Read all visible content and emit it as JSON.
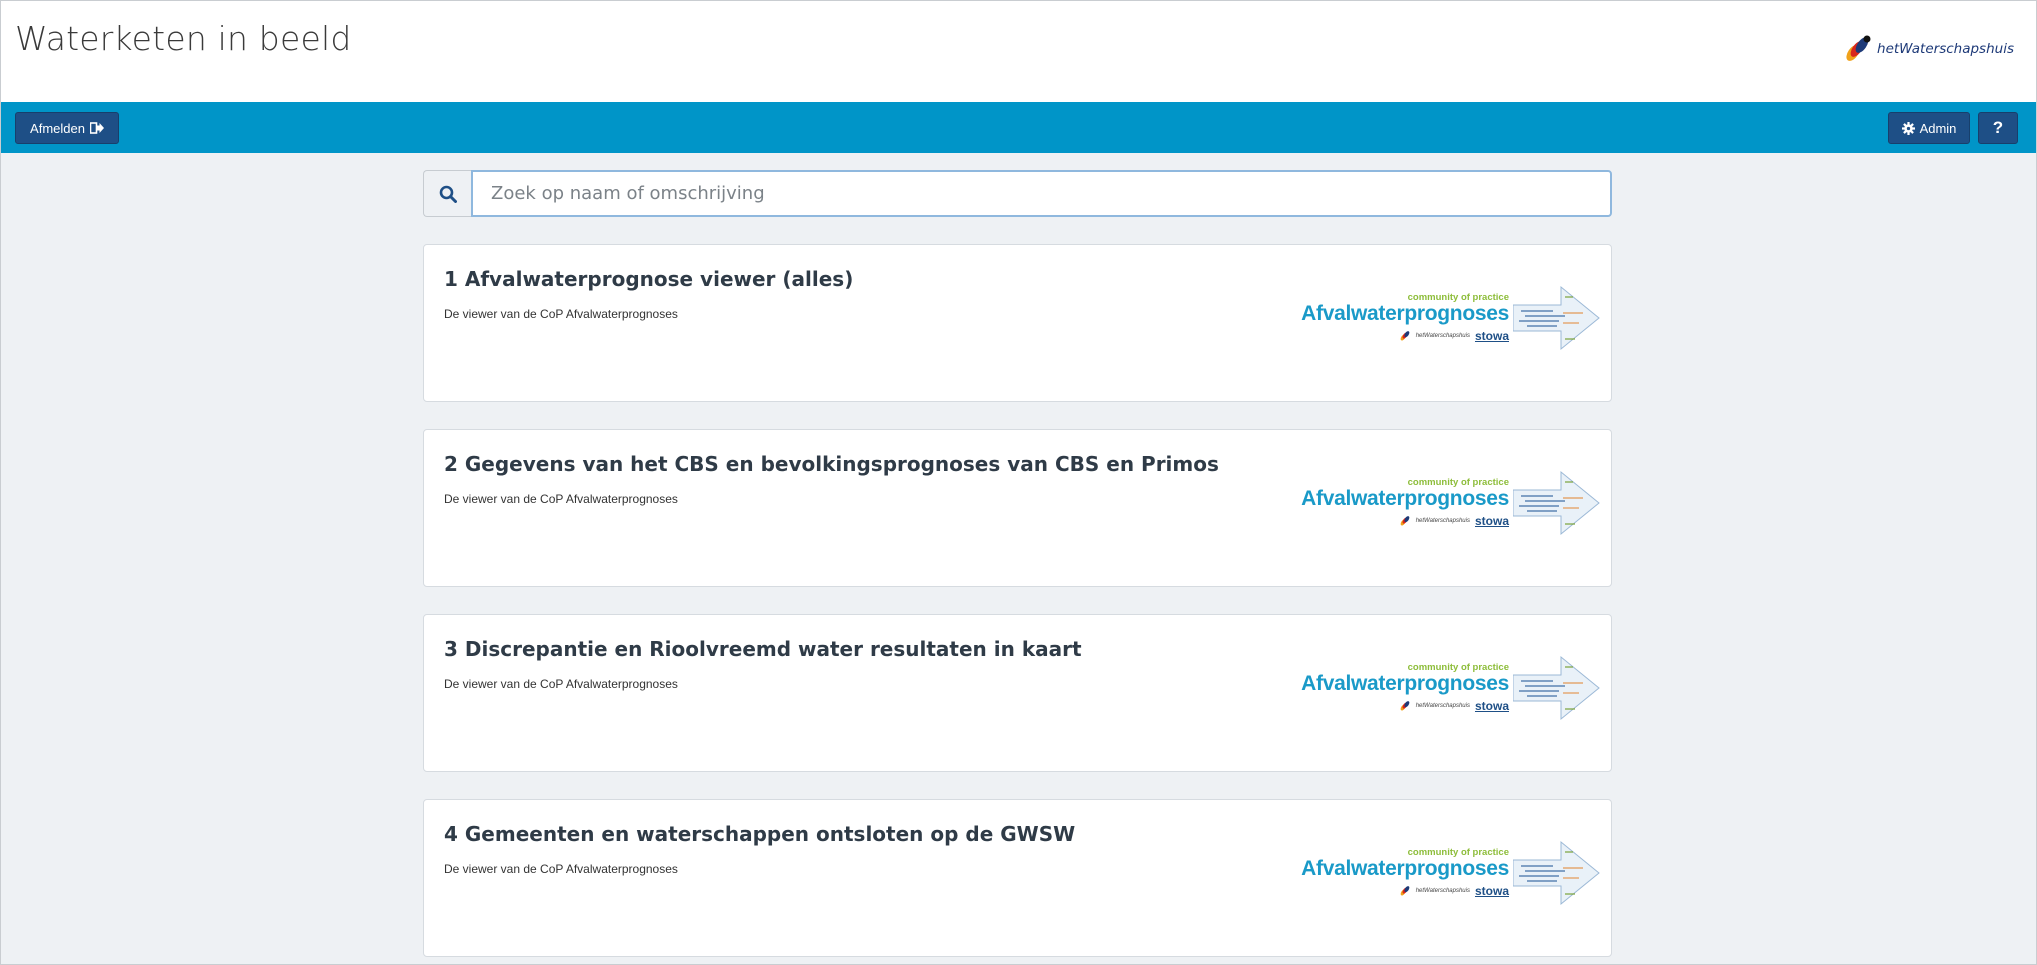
{
  "header": {
    "title": "Waterketen in beeld",
    "brand": "hetWaterschapshuis"
  },
  "navbar": {
    "logout_label": "Afmelden",
    "admin_label": "Admin",
    "help_label": "?"
  },
  "search": {
    "placeholder": "Zoek op naam of omschrijving",
    "value": ""
  },
  "cards": [
    {
      "title": "1 Afvalwaterprognose viewer (alles)",
      "description": "De viewer van de CoP Afvalwaterprognoses"
    },
    {
      "title": "2 Gegevens van het CBS en bevolkingsprognoses van CBS en Primos",
      "description": "De viewer van de CoP Afvalwaterprognoses"
    },
    {
      "title": "3 Discrepantie en Rioolvreemd water resultaten in kaart",
      "description": "De viewer van de CoP Afvalwaterprognoses"
    },
    {
      "title": "4 Gemeenten en waterschappen ontsloten op de GWSW",
      "description": "De viewer van de CoP Afvalwaterprognoses"
    }
  ],
  "card_logo": {
    "tagline": "community of practice",
    "name": "Afvalwaterprognoses",
    "partner1": "hetWaterschapshuis",
    "partner2": "stowa"
  },
  "colors": {
    "navbar": "#0095c8",
    "button": "#1e4f86",
    "logo_blue": "#1a9ac8",
    "logo_green": "#8dbd3a"
  },
  "icons": {
    "logout": "sign-out-icon",
    "admin": "gear-icon",
    "search": "search-icon"
  }
}
